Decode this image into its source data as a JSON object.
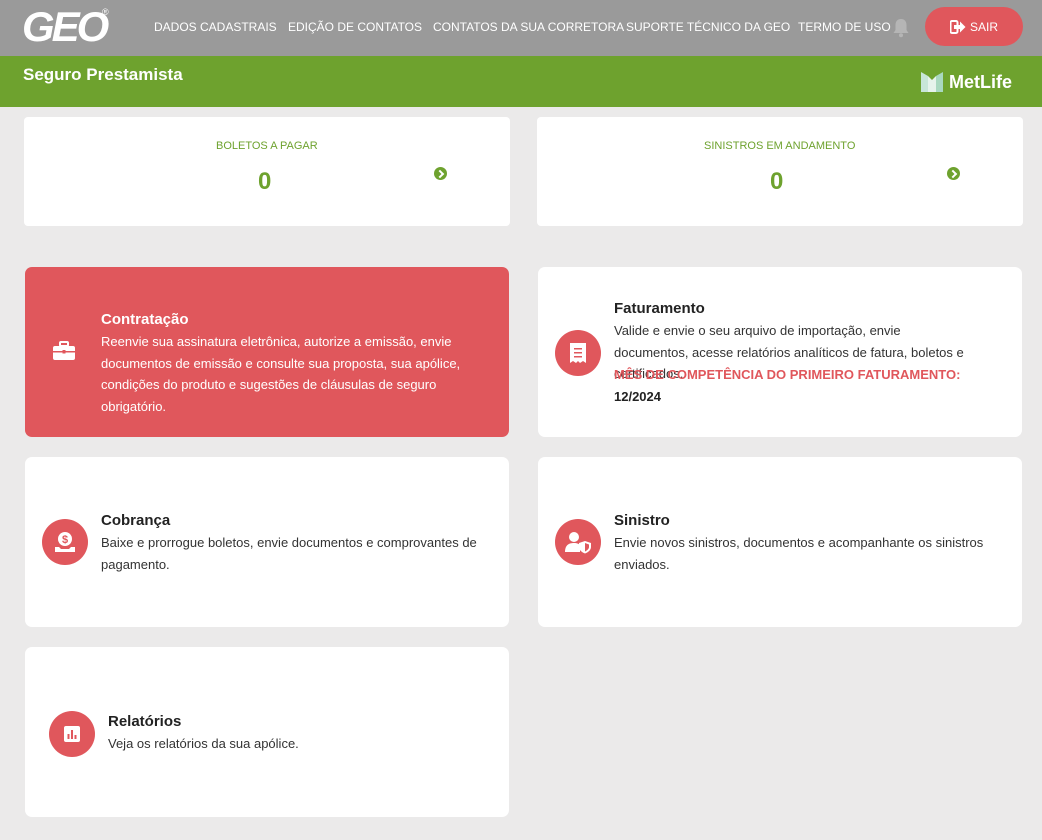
{
  "app": {
    "logo_text": "GEO",
    "logo_mark": "®"
  },
  "nav": {
    "links": [
      "DADOS CADASTRAIS",
      "EDIÇÃO DE CONTATOS",
      "CONTATOS DA SUA CORRETORA",
      "SUPORTE TÉCNICO DA GEO",
      "TERMO DE USO"
    ],
    "bell_icon": "bell-icon",
    "logout_label": "SAIR",
    "logout_icon": "sign-out-icon"
  },
  "banner": {
    "title": "Seguro Prestamista",
    "partner": "MetLife"
  },
  "summary": [
    {
      "label": "BOLETOS A PAGAR",
      "value": "0"
    },
    {
      "label": "SINISTROS EM ANDAMENTO",
      "value": "0"
    }
  ],
  "cards": {
    "contratacao": {
      "title": "Contratação",
      "desc": "Reenvie sua assinatura eletrônica, autorize a emissão, envie documentos de emissão e consulte sua proposta, sua apólice, condições do produto e sugestões de cláusulas de seguro obrigatório.",
      "icon": "briefcase-icon"
    },
    "faturamento": {
      "title": "Faturamento",
      "desc": "Valide e envie o seu arquivo de importação, envie documentos, acesse relatórios analíticos de fatura, boletos e certificados.",
      "highlight": "MÊS DE COMPETÊNCIA DO PRIMEIRO FATURAMENTO:",
      "highlight_value": "12/2024",
      "icon": "receipt-icon"
    },
    "cobranca": {
      "title": "Cobrança",
      "desc": "Baixe e prorrogue boletos, envie documentos e comprovantes de pagamento.",
      "icon": "money-hand-icon"
    },
    "sinistro": {
      "title": "Sinistro",
      "desc": "Envie novos sinistros, documentos e acompanhante os sinistros enviados.",
      "icon": "user-shield-icon"
    },
    "relatorios": {
      "title": "Relatórios",
      "desc": "Veja os relatórios da sua apólice.",
      "icon": "chart-icon"
    }
  },
  "colors": {
    "accent_red": "#e0575c",
    "brand_green": "#6ea22e",
    "topbar_gray": "#9a9a9a",
    "background": "#ebeaea"
  }
}
